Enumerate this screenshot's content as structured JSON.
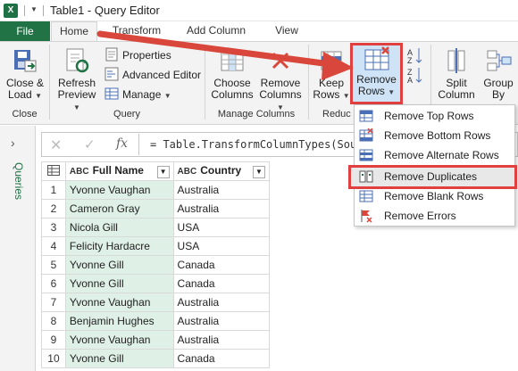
{
  "window": {
    "title": "Table1 - Query Editor",
    "app_icon": "X"
  },
  "tabs": {
    "file": "File",
    "home": "Home",
    "transform": "Transform",
    "add_column": "Add Column",
    "view": "View"
  },
  "ribbon": {
    "close_load": {
      "line1": "Close &",
      "line2": "Load"
    },
    "refresh_preview": {
      "line1": "Refresh",
      "line2": "Preview"
    },
    "properties": "Properties",
    "advanced_editor": "Advanced Editor",
    "manage": "Manage",
    "choose_columns": {
      "line1": "Choose",
      "line2": "Columns"
    },
    "remove_columns": {
      "line1": "Remove",
      "line2": "Columns"
    },
    "keep_rows": {
      "line1": "Keep",
      "line2": "Rows"
    },
    "remove_rows": {
      "line1": "Remove",
      "line2": "Rows"
    },
    "split_column": {
      "line1": "Split",
      "line2": "Column"
    },
    "group_by": {
      "line1": "Group",
      "line2": "By"
    },
    "groups": {
      "close": "Close",
      "query": "Query",
      "manage_columns": "Manage Columns",
      "reduce": "Reduc"
    }
  },
  "nav": {
    "label": "Queries",
    "chevron": "›"
  },
  "formula": {
    "cancel": "✕",
    "confirm": "✓",
    "fx": "fx",
    "text": "= Table.TransformColumnTypes(Source"
  },
  "table": {
    "columns": [
      {
        "type": "ABC",
        "name": "Full Name"
      },
      {
        "type": "ABC",
        "name": "Country"
      }
    ],
    "rows": [
      [
        "1",
        "Yvonne Vaughan",
        "Australia"
      ],
      [
        "2",
        "Cameron Gray",
        "Australia"
      ],
      [
        "3",
        "Nicola Gill",
        "USA"
      ],
      [
        "4",
        "Felicity Hardacre",
        "USA"
      ],
      [
        "5",
        "Yvonne Gill",
        "Canada"
      ],
      [
        "6",
        "Yvonne Gill",
        "Canada"
      ],
      [
        "7",
        "Yvonne Vaughan",
        "Australia"
      ],
      [
        "8",
        "Benjamin Hughes",
        "Australia"
      ],
      [
        "9",
        "Yvonne Vaughan",
        "Australia"
      ],
      [
        "10",
        "Yvonne Gill",
        "Canada"
      ]
    ]
  },
  "dropdown": {
    "items": [
      {
        "label": "Remove Top Rows",
        "icon": "remove-top-rows-icon"
      },
      {
        "label": "Remove Bottom Rows",
        "icon": "remove-bottom-rows-icon"
      },
      {
        "label": "Remove Alternate Rows",
        "icon": "remove-alternate-rows-icon"
      },
      {
        "label": "Remove Duplicates",
        "icon": "remove-duplicates-icon"
      },
      {
        "label": "Remove Blank Rows",
        "icon": "remove-blank-rows-icon"
      },
      {
        "label": "Remove Errors",
        "icon": "remove-errors-icon"
      }
    ]
  },
  "colors": {
    "excel_green": "#217346",
    "highlight_red": "#e04040",
    "selected_column": "#dff0e6"
  }
}
